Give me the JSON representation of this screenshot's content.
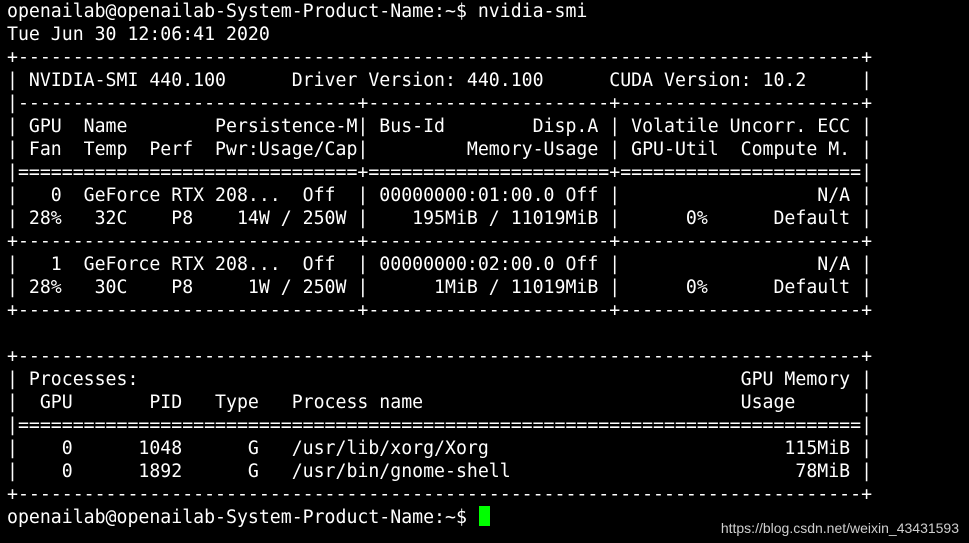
{
  "terminal": {
    "background": "#000000",
    "foreground": "#ffffff",
    "cursor_color": "#00ff00",
    "lines": [
      "openailab@openailab-System-Product-Name:~$ nvidia-smi",
      "Tue Jun 30 12:06:41 2020",
      "+-----------------------------------------------------------------------------+",
      "| NVIDIA-SMI 440.100      Driver Version: 440.100      CUDA Version: 10.2     |",
      "|-------------------------------+----------------------+----------------------+",
      "| GPU  Name        Persistence-M| Bus-Id        Disp.A | Volatile Uncorr. ECC |",
      "| Fan  Temp  Perf  Pwr:Usage/Cap|         Memory-Usage | GPU-Util  Compute M. |",
      "|===============================+======================+======================|",
      "|   0  GeForce RTX 208...  Off  | 00000000:01:00.0 Off |                  N/A |",
      "| 28%   32C    P8    14W / 250W |    195MiB / 11019MiB |      0%      Default |",
      "+-------------------------------+----------------------+----------------------+",
      "|   1  GeForce RTX 208...  Off  | 00000000:02:00.0 Off |                  N/A |",
      "| 28%   30C    P8     1W / 250W |      1MiB / 11019MiB |      0%      Default |",
      "+-------------------------------+----------------------+----------------------+",
      "",
      "+-----------------------------------------------------------------------------+",
      "| Processes:                                                       GPU Memory |",
      "|  GPU       PID   Type   Process name                             Usage      |",
      "|=============================================================================|",
      "|    0      1048      G   /usr/lib/xorg/Xorg                           115MiB |",
      "|    0      1892      G   /usr/bin/gnome-shell                          78MiB |",
      "+-----------------------------------------------------------------------------+"
    ],
    "prompt": "openailab@openailab-System-Product-Name:~$ "
  },
  "watermark": "https://blog.csdn.net/weixin_43431593"
}
